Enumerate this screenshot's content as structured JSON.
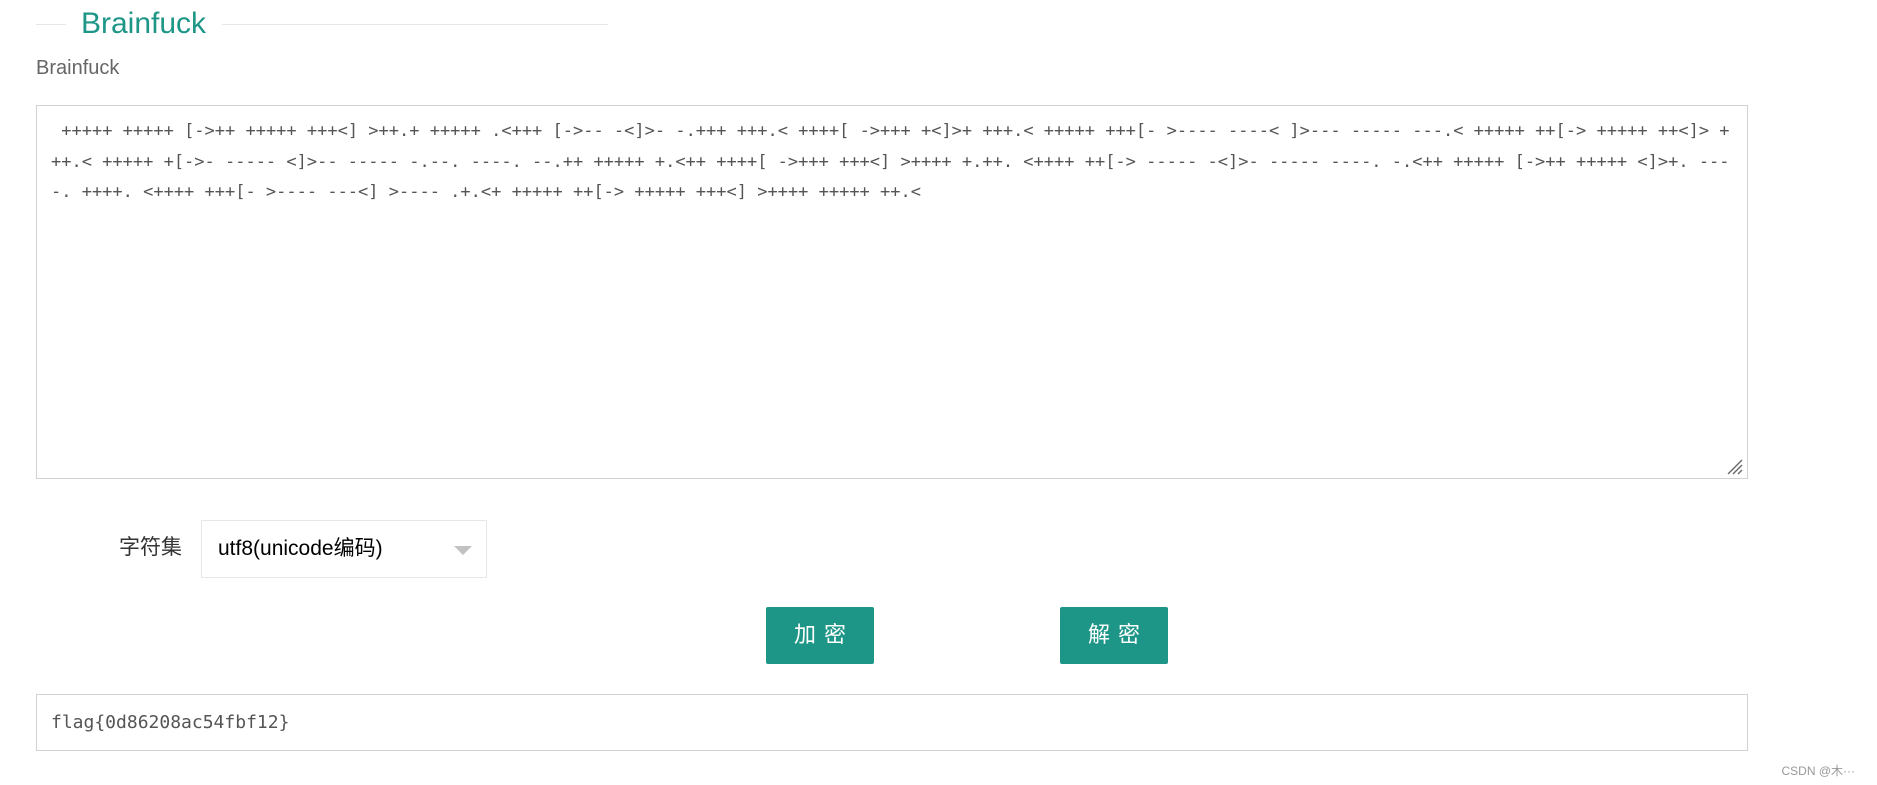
{
  "header": {
    "title": "Brainfuck",
    "subtitle": "Brainfuck"
  },
  "editor": {
    "code": " +++++ +++++ [->++ +++++ +++<] >++.+ +++++ .<+++ [->-- -<]>- -.+++ +++.< ++++[ ->+++ +<]>+ +++.< +++++ +++[- >---- ----< ]>--- ----- ---.< +++++ ++[-> +++++ ++<]> +++.< +++++ +[->- ----- <]>-- ----- -.--. ----. --.++ +++++ +.<++ ++++[ ->+++ +++<] >++++ +.++. <++++ ++[-> ----- -<]>- ----- ----. -.<++ +++++ [->++ +++++ <]>+. ----. ++++. <++++ +++[- >---- ---<] >---- .+.<+ +++++ ++[-> +++++ +++<] >++++ +++++ ++.<"
  },
  "charset": {
    "label": "字符集",
    "selected": "utf8(unicode编码)"
  },
  "buttons": {
    "encrypt": "加密",
    "decrypt": "解密"
  },
  "result": {
    "value": "flag{0d86208ac54fbf12}"
  },
  "footer": {
    "watermark": "CSDN @木···"
  },
  "colors": {
    "accent": "#1e9687",
    "border": "#d2d2d2"
  }
}
